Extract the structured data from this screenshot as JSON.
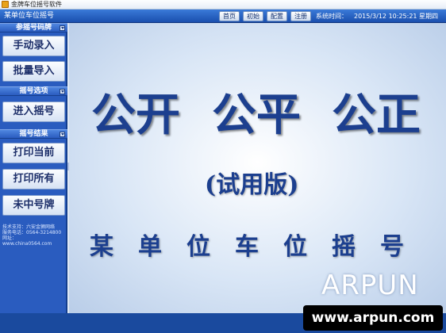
{
  "window": {
    "title": "金牌车位摇号软件"
  },
  "header": {
    "unit_name": "某单位车位摇号",
    "buttons": [
      "首页",
      "初始",
      "配置",
      "注册"
    ],
    "clock_label": "系统时间：",
    "clock_value": "2015/3/12 10:25:21 星期四"
  },
  "sidebar": {
    "sections": [
      {
        "title": "参摇号码牌",
        "items": [
          "手动录入",
          "批量导入"
        ]
      },
      {
        "title": "摇号选项",
        "items": [
          "进入摇号"
        ]
      },
      {
        "title": "摇号结果",
        "items": [
          "打印当前",
          "打印所有",
          "未中号牌"
        ]
      }
    ],
    "support": [
      "技术支持：六安金狮网络",
      "服务电话：0564-3214800",
      "网址：www.china0564.com"
    ]
  },
  "main": {
    "slogans": [
      "公开",
      "公平",
      "公正"
    ],
    "trial": "(试用版)",
    "title": "某单位车位摇号"
  },
  "watermark": {
    "logo": "ARPUN",
    "url": "www.arpun.com"
  },
  "colors": {
    "sidebar": "#2a5cbf",
    "header": "#1a4fae",
    "title_text": "#1c3f8f"
  }
}
